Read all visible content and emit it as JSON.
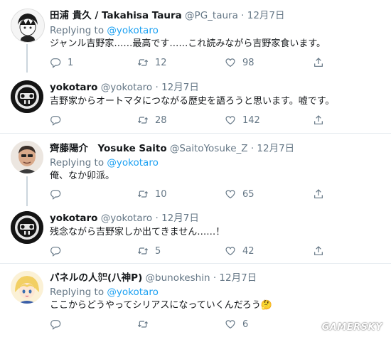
{
  "tweets": [
    {
      "name": "田浦 貴久 / Takahisa Taura",
      "handle": "@PG_taura",
      "dot": "·",
      "date": "12月7日",
      "replying_prefix": "Replying to",
      "replying_to": "@yokotaro",
      "text": "ジャンル吉野家……最高です……これ読みながら吉野家食います。",
      "replies": "1",
      "retweets": "12",
      "likes": "98"
    },
    {
      "name": "yokotaro",
      "handle": "@yokotaro",
      "dot": "·",
      "date": "12月7日",
      "text": "吉野家からオートマタにつながる歴史を語ろうと思います。嘘です。",
      "replies": "",
      "retweets": "28",
      "likes": "142"
    },
    {
      "name": "齊藤陽介　Yosuke Saito",
      "handle": "@SaitoYosuke_Z",
      "dot": "·",
      "date": "12月7日",
      "replying_prefix": "Replying to",
      "replying_to": "@yokotaro",
      "text": "俺、なか卯派。",
      "replies": "",
      "retweets": "10",
      "likes": "65"
    },
    {
      "name": "yokotaro",
      "handle": "@yokotaro",
      "dot": "·",
      "date": "12月7日",
      "text": "残念ながら吉野家しか出てきません……！",
      "replies": "",
      "retweets": "5",
      "likes": "42"
    },
    {
      "name": "パネルの人㌍(八神P)",
      "handle": "@bunokeshin",
      "dot": "·",
      "date": "12月7日",
      "replying_prefix": "Replying to",
      "replying_to": "@yokotaro",
      "text": "ここからどうやってシリアスになっていくんだろう🤔",
      "replies": "",
      "retweets": "",
      "likes": "6"
    }
  ],
  "watermark": "GAMERSKY",
  "colors": {
    "link": "#1da1f2",
    "muted": "#657786",
    "thread_line": "#ccd6dd"
  },
  "icons": [
    "reply-icon",
    "retweet-icon",
    "like-icon",
    "share-icon"
  ]
}
